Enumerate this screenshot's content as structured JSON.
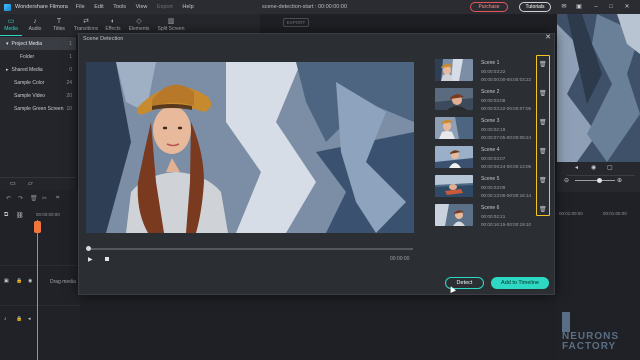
{
  "app": {
    "name": "Wondershare Filmora",
    "menu": [
      "File",
      "Edit",
      "Tools",
      "View",
      "Export",
      "Help"
    ],
    "document_title": "scene-detection-start : 00:00:00:00",
    "purchase_label": "Purchase",
    "tutorials_label": "Tutorials",
    "export_label": "EXPORT"
  },
  "toolbar": {
    "tabs": [
      {
        "label": "Media",
        "icon": "folder-icon",
        "active": true
      },
      {
        "label": "Audio",
        "icon": "music-icon",
        "active": false
      },
      {
        "label": "Titles",
        "icon": "text-icon",
        "active": false
      },
      {
        "label": "Transitions",
        "icon": "transition-icon",
        "active": false
      },
      {
        "label": "Effects",
        "icon": "effects-icon",
        "active": false
      },
      {
        "label": "Elements",
        "icon": "elements-icon",
        "active": false
      },
      {
        "label": "Split Screen",
        "icon": "split-screen-icon",
        "active": false
      }
    ]
  },
  "media_panel": {
    "items": [
      {
        "label": "Project Media",
        "count": "1",
        "selected": true
      },
      {
        "label": "Folder",
        "count": "1",
        "selected": false
      },
      {
        "label": "Shared Media",
        "count": "0",
        "selected": false
      },
      {
        "label": "Sample Color",
        "count": "24",
        "selected": false
      },
      {
        "label": "Sample Video",
        "count": "20",
        "selected": false
      },
      {
        "label": "Sample Green Screen",
        "count": "10",
        "selected": false
      }
    ]
  },
  "timeline": {
    "timecode_start": "00:00:00:00",
    "timecode_right_1": "00:01:00:00",
    "timecode_right_2": "00:01:05:00",
    "drop_hint": "Drag media"
  },
  "dialog": {
    "title": "Scene Detection",
    "video_time": "00:00:00",
    "detect_label": "Detect",
    "add_label": "Add to Timeline",
    "scenes": [
      {
        "name": "Scene 1",
        "duration": "00:00:03:22",
        "range": "00:00:00:00-00:00:03:22"
      },
      {
        "name": "Scene 2",
        "duration": "00:00:03:08",
        "range": "00:00:03:22-00:00:07:05"
      },
      {
        "name": "Scene 3",
        "duration": "00:00:02:19",
        "range": "00:00:07:05-00:00:09:24"
      },
      {
        "name": "Scene 4",
        "duration": "00:00:03:07",
        "range": "00:00:09:24-00:00:13:05"
      },
      {
        "name": "Scene 5",
        "duration": "00:00:03:09",
        "range": "00:00:13:06-00:00:16:14"
      },
      {
        "name": "Scene 6",
        "duration": "00:00:02:21",
        "range": "00:00:16:15-00:00:19:10"
      }
    ]
  },
  "watermark": {
    "line1": "NEURONS",
    "line2": "FACTORY"
  },
  "colors": {
    "accent": "#2ed9c3",
    "highlight": "#f3c623",
    "purchase": "#e0565b",
    "playhead": "#f2753b"
  }
}
